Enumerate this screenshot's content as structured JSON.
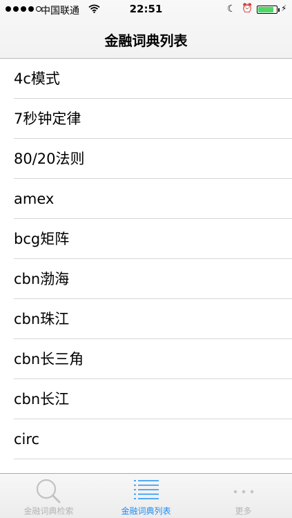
{
  "status_bar": {
    "carrier": "中国联通",
    "time": "22:51",
    "battery_level": 0.85,
    "colors": {
      "battery": "#4cd964"
    }
  },
  "nav": {
    "title": "金融词典列表"
  },
  "list": {
    "items": [
      "4c模式",
      "7秒钟定律",
      "80/20法则",
      "amex",
      "bcg矩阵",
      "cbn渤海",
      "cbn珠江",
      "cbn长三角",
      "cbn长江",
      "circ",
      ""
    ]
  },
  "tabbar": {
    "tabs": [
      {
        "label": "金融词典检索",
        "icon": "magnifier-icon",
        "active": false
      },
      {
        "label": "金融词典列表",
        "icon": "list-icon",
        "active": true
      },
      {
        "label": "更多",
        "icon": "more-dots-icon",
        "active": false
      }
    ],
    "colors": {
      "active": "#1e8ff5",
      "inactive": "#b5b5b5"
    }
  }
}
